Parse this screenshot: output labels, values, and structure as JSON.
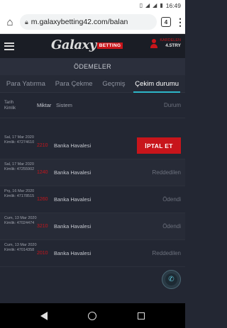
{
  "statusbar": {
    "signal_icon": "vibrate-icon",
    "time": "16:49"
  },
  "browser": {
    "url": "m.galaxybetting42.com/balan",
    "tab_count": "4"
  },
  "header": {
    "logo_text": "Galaxy",
    "logo_badge": "BETTING",
    "balance": "4.5TRY",
    "username": "KARDELEN"
  },
  "page": {
    "title": "ÖDEMELER"
  },
  "tabs": [
    {
      "label": "Para Yatırma"
    },
    {
      "label": "Para Çekme"
    },
    {
      "label": "Geçmiş"
    },
    {
      "label": "Çekim durumu"
    }
  ],
  "table": {
    "headers": {
      "date_line1": "Tarih",
      "date_line2": "Kimlik",
      "amount": "Miktar",
      "system": "Sistem",
      "status": "Durum"
    },
    "rows": [
      {
        "date": "Sal, 17 Mar 2020",
        "id": "Kimlik: 47274610",
        "amount": "2210",
        "system": "Banka Havalesi",
        "status": "İPTAL ET"
      },
      {
        "date": "Sal, 17 Mar 2020",
        "id": "Kimlik: 47255902",
        "amount": "1240",
        "system": "Banka Havalesi",
        "status": "Reddedilen"
      },
      {
        "date": "Prş, 16 Mar 2020",
        "id": "Kimlik: 47178515",
        "amount": "1260",
        "system": "Banka Havalesi",
        "status": "Ödendi"
      },
      {
        "date": "Cum, 13 Mar 2020",
        "id": "Kimlik: 47024474",
        "amount": "3210",
        "system": "Banka Havalesi",
        "status": "Ödendi"
      },
      {
        "date": "Cum, 13 Mar 2020",
        "id": "Kimlik: 47014358",
        "amount": "2010",
        "system": "Banka Havalesi",
        "status": "Reddedilen"
      }
    ]
  },
  "colors": {
    "accent": "#c8151b",
    "tab_underline": "#2db6c8",
    "background": "#232733"
  }
}
